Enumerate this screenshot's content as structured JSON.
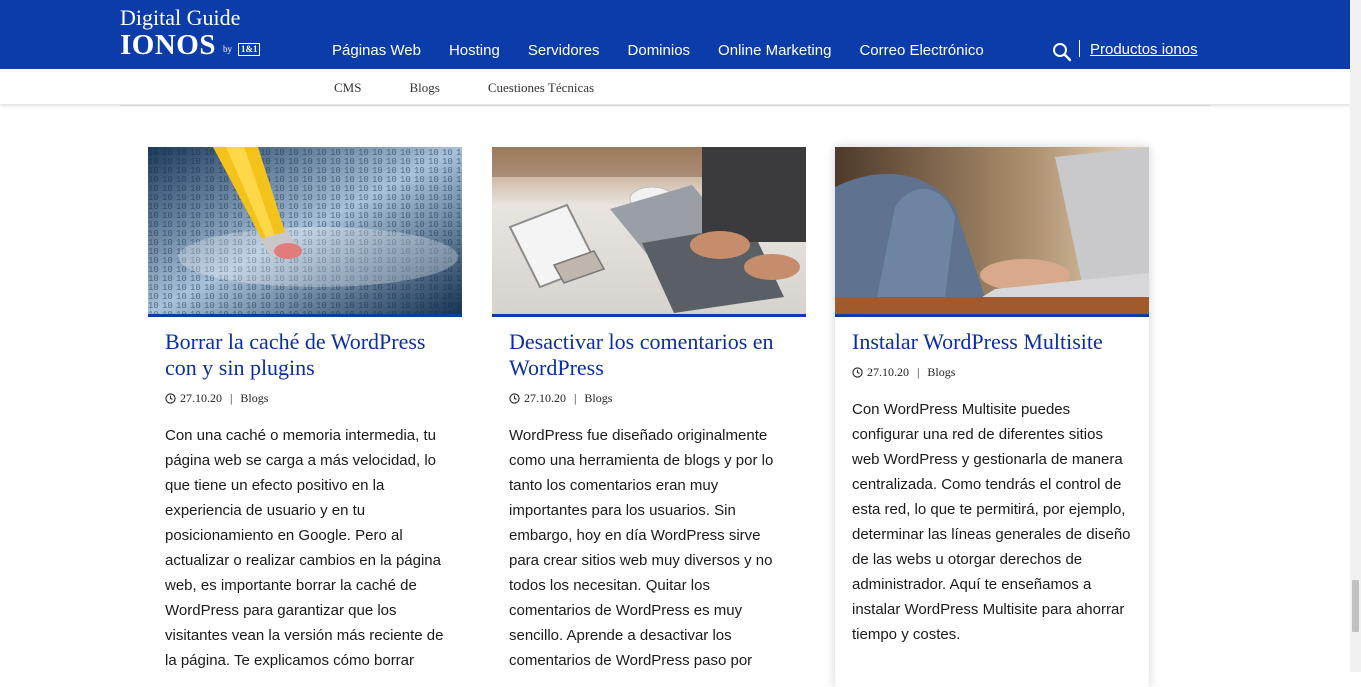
{
  "header": {
    "logo_line1": "Digital Guide",
    "logo_brand": "IONOS",
    "logo_by": "by",
    "logo_partner": "1&1",
    "nav": [
      "Páginas Web",
      "Hosting",
      "Servidores",
      "Dominios",
      "Online Marketing",
      "Correo Electrónico"
    ],
    "products_label": "Productos ionos",
    "search_icon": "search-icon"
  },
  "subnav": [
    "CMS",
    "Blogs",
    "Cuestiones Técnicas"
  ],
  "colors": {
    "brand_blue": "#0b3caa",
    "title_blue": "#0b2fa3"
  },
  "cards": [
    {
      "title": "Borrar la caché de WordPress con y sin plugins",
      "date": "27.10.20",
      "category": "Blogs",
      "excerpt": "Con una caché o memoria intermedia, tu página web se carga a más velocidad, lo que tiene un efecto positivo en la experiencia de usuario y en tu posicionamiento en Google. Pero al actualizar o realizar cambios en la página web, es importante borrar la caché de WordPress para garantizar que los visitantes vean la versión más reciente de la página. Te explicamos cómo borrar"
    },
    {
      "title": "Desactivar los comentarios en WordPress",
      "date": "27.10.20",
      "category": "Blogs",
      "excerpt": "WordPress fue diseñado originalmente como una herramienta de blogs y por lo tanto los comentarios eran muy importantes para los usuarios. Sin embargo, hoy en día WordPress sirve para crear sitios web muy diversos y no todos los necesitan. Quitar los comentarios de WordPress es muy sencillo. Aprende a desactivar los comentarios de WordPress paso por"
    },
    {
      "title": "Instalar WordPress Multisite",
      "date": "27.10.20",
      "category": "Blogs",
      "excerpt": "Con WordPress Multisite puedes configurar una red de diferentes sitios web WordPress y gestionarla de manera centralizada. Como tendrás el control de esta red, lo que te permitirá, por ejemplo, determinar las líneas generales de diseño de las webs u otorgar derechos de administrador. Aquí te enseñamos a instalar WordPress Multisite para ahorrar tiempo y costes."
    }
  ]
}
